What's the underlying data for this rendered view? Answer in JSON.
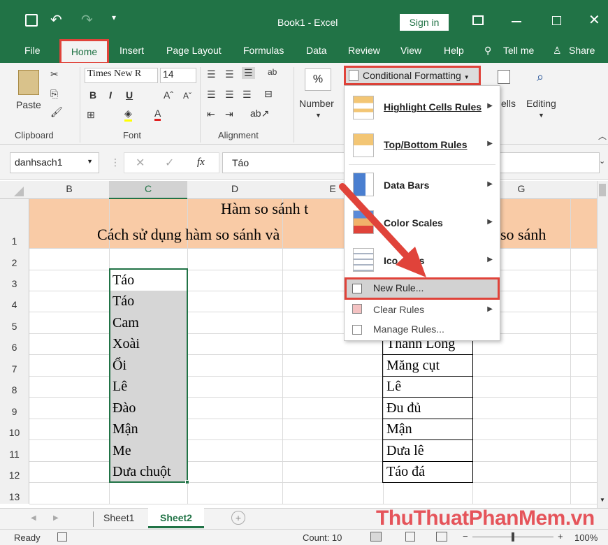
{
  "window": {
    "title": "Book1  -  Excel",
    "sign_in": "Sign in",
    "save_icon": "save-icon",
    "undo_icon": "undo-icon"
  },
  "tabs": [
    "File",
    "Home",
    "Insert",
    "Page Layout",
    "Formulas",
    "Data",
    "Review",
    "View",
    "Help"
  ],
  "tell_me": "Tell me",
  "share": "Share",
  "ribbon": {
    "paste": "Paste",
    "font_name": "Times New R",
    "font_size": "14",
    "bold": "B",
    "italic": "I",
    "underline": "U",
    "wrap": "ab",
    "percent": "%",
    "number": "Number",
    "conditional_formatting": "Conditional Formatting",
    "cells": "ells",
    "editing": "Editing",
    "groups": {
      "clipboard": "Clipboard",
      "font": "Font",
      "alignment": "Alignment"
    }
  },
  "formula_bar": {
    "name_box": "danhsach1",
    "fx": "fx",
    "value": "Táo"
  },
  "columns": [
    "B",
    "C",
    "D",
    "E",
    "G"
  ],
  "rows": [
    "1",
    "2",
    "3",
    "4",
    "5",
    "6",
    "7",
    "8",
    "9",
    "10",
    "11",
    "12",
    "13"
  ],
  "sheet": {
    "title_line1": "Hàm so sánh t",
    "title_line2_left": "Cách sử dụng hàm so sánh và",
    "title_line2_right": "so sánh",
    "list_c": [
      "Táo",
      "Táo",
      "Cam",
      "Xoài",
      "Ổi",
      "Lê",
      "Đào",
      "Mận",
      "Me",
      "Dưa chuột"
    ],
    "list_f": [
      "Thanh Long",
      "Măng cụt",
      "Lê",
      "Đu đủ",
      "Mận",
      "Dưa lê",
      "Táo đá"
    ]
  },
  "menu": {
    "items": [
      {
        "label": "Highlight Cells Rules",
        "icon": "highlight-cells-icon"
      },
      {
        "label": "Top/Bottom Rules",
        "icon": "top-bottom-icon"
      },
      {
        "label": "Data Bars",
        "icon": "data-bars-icon"
      },
      {
        "label": "Color Scales",
        "icon": "color-scales-icon"
      },
      {
        "label": "Icon Sets",
        "icon": "icon-sets-icon"
      }
    ],
    "new_rule": "New Rule...",
    "clear_rules": "Clear Rules",
    "manage_rules": "Manage Rules...",
    "icon_sets_visible": "Ico",
    "icon_sets_tail": "ets"
  },
  "sheet_tabs": [
    "Sheet1",
    "Sheet2"
  ],
  "watermark": "ThuThuatPhanMem.vn",
  "status": {
    "ready": "Ready",
    "count": "Count: 10",
    "zoom": "100%"
  },
  "colors": {
    "excel_green": "#217346",
    "header_fill": "#f9cba6",
    "highlight_red": "#e0433a",
    "selection_border": "#217346"
  }
}
